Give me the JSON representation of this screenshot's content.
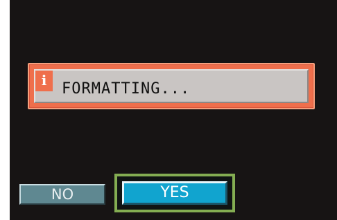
{
  "dialog": {
    "icon": "info-icon",
    "icon_glyph": "i",
    "message": "FORMATTING..."
  },
  "buttons": {
    "no_label": "NO",
    "yes_label": "YES",
    "selected": "YES"
  },
  "colors": {
    "screen_background": "#171414",
    "dialog_frame": "#ef6f4c",
    "dialog_panel": "#c9c5c3",
    "selected_button": "#11a4cf",
    "unselected_button": "#5f8891",
    "selection_highlight": "#84ad52"
  }
}
